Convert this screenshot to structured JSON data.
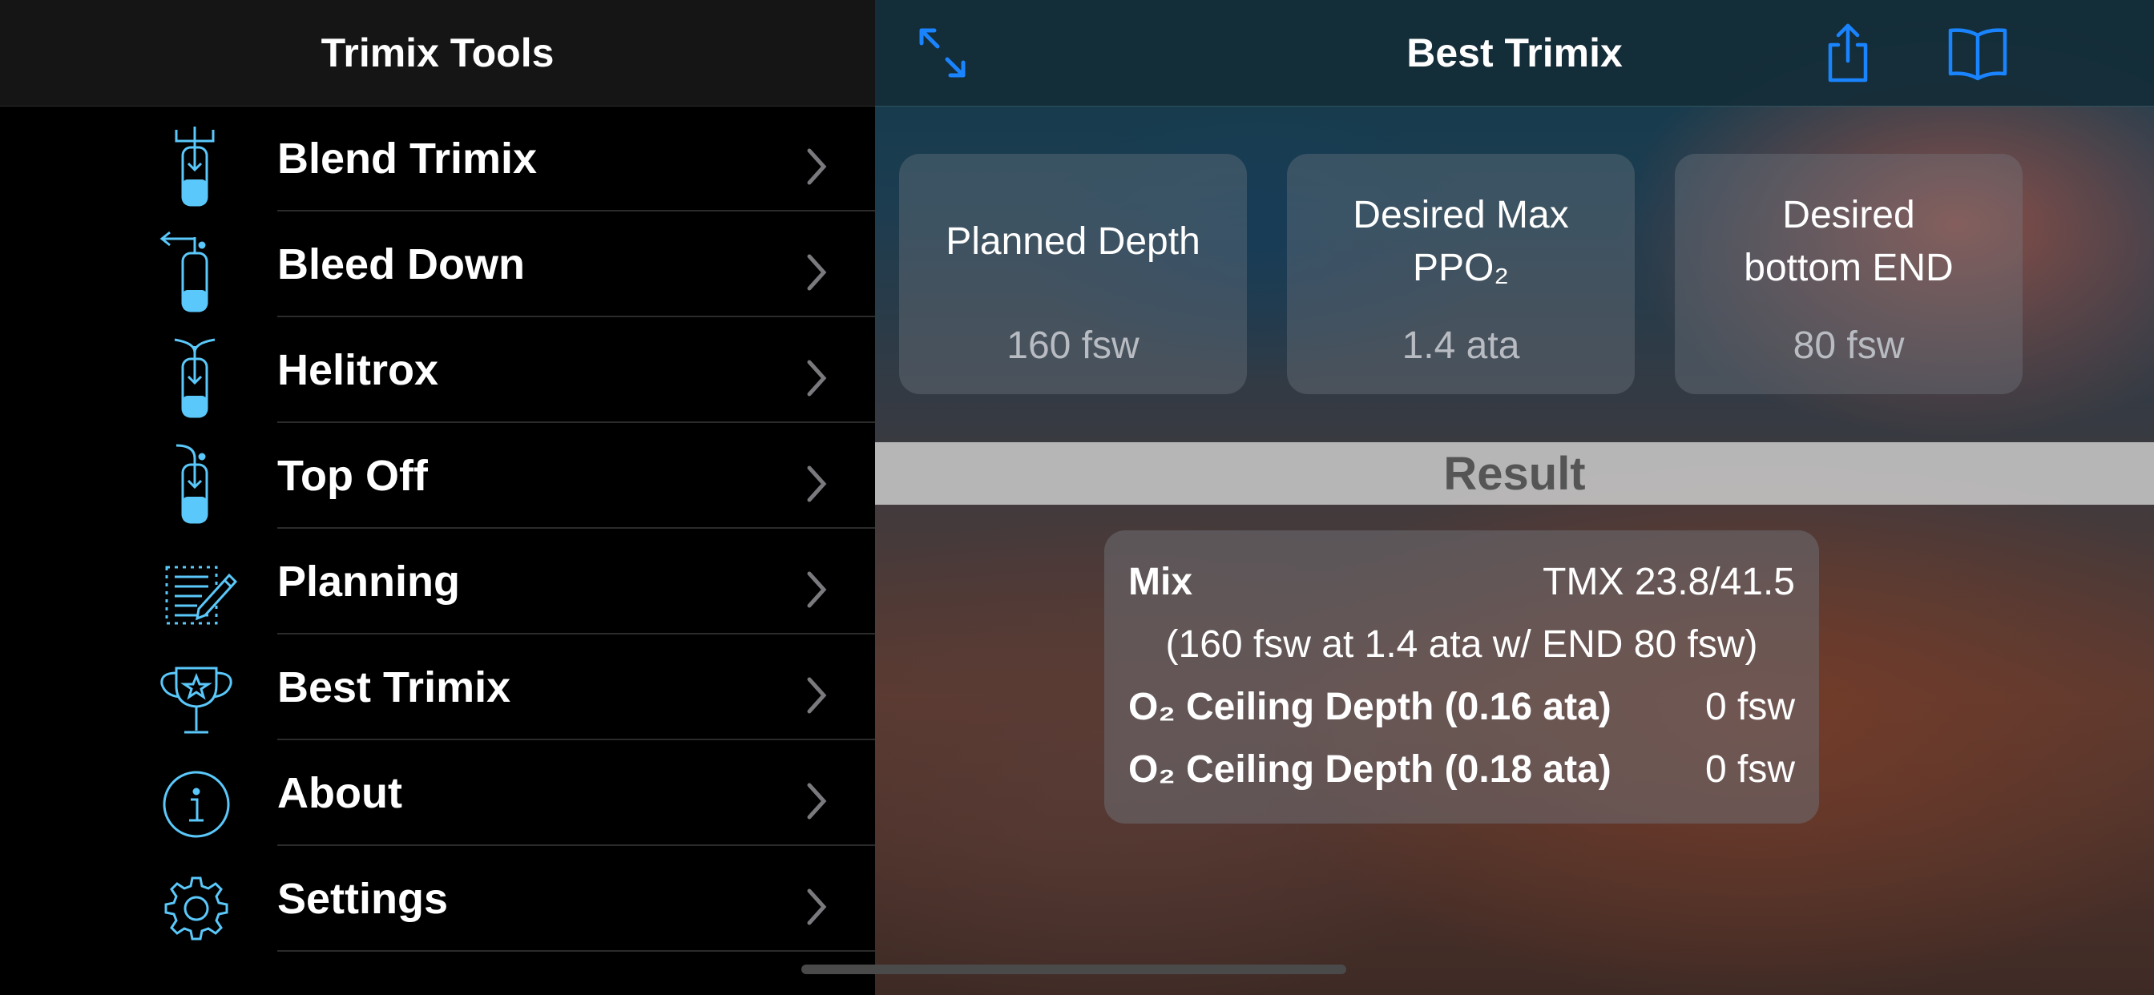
{
  "sidebar": {
    "title": "Trimix Tools",
    "items": [
      {
        "label": "Blend Trimix",
        "icon": "tank-fill-icon"
      },
      {
        "label": "Bleed Down",
        "icon": "tank-bleed-icon"
      },
      {
        "label": "Helitrox",
        "icon": "tank-helitrox-icon"
      },
      {
        "label": "Top Off",
        "icon": "tank-top-off-icon"
      },
      {
        "label": "Planning",
        "icon": "notepad-pencil-icon"
      },
      {
        "label": "Best Trimix",
        "icon": "trophy-icon"
      },
      {
        "label": "About",
        "icon": "info-icon"
      },
      {
        "label": "Settings",
        "icon": "gear-icon"
      }
    ]
  },
  "main": {
    "title": "Best Trimix",
    "inputs": [
      {
        "label": "Planned Depth",
        "value": "160 fsw"
      },
      {
        "label": "Desired Max PPO₂",
        "value": "1.4 ata"
      },
      {
        "label": "Desired bottom END",
        "value": "80 fsw"
      }
    ],
    "result": {
      "heading": "Result",
      "mix_label": "Mix",
      "mix_value": "TMX 23.8/41.5",
      "mix_detail": "(160 fsw at 1.4 ata w/ END 80 fsw)",
      "ceiling_1_label": "O₂ Ceiling Depth (0.16 ata)",
      "ceiling_1_value": "0 fsw",
      "ceiling_2_label": "O₂ Ceiling Depth (0.18 ata)",
      "ceiling_2_value": "0 fsw"
    }
  },
  "colors": {
    "accent": "#1a84ff",
    "icon_blue": "#5ac8fa",
    "sidebar_bg": "#000000",
    "header_bg": "#151515"
  }
}
